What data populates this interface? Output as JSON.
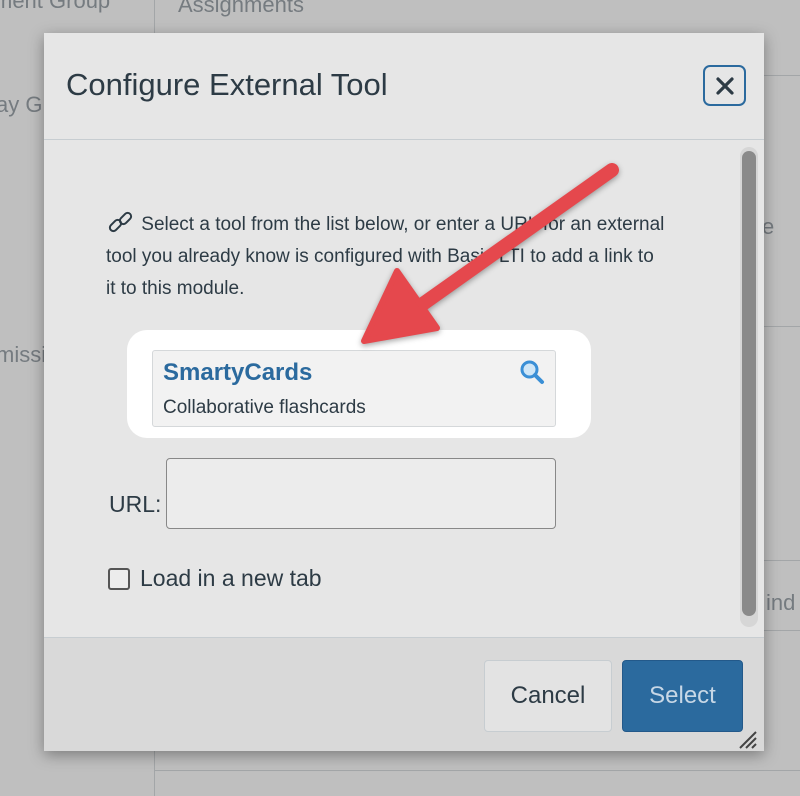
{
  "background": {
    "left_items": [
      "ment Group",
      "ay G",
      "missi"
    ],
    "main_items": [
      "Assignments",
      "e",
      "ind"
    ]
  },
  "modal": {
    "title": "Configure External Tool",
    "close_icon": "close-icon",
    "intro_text": "Select a tool from the list below, or enter a URL for an external tool you already know is configured with Basic LTI to add a link to it to this module.",
    "link_icon": "link-icon",
    "tools": [
      {
        "name": "SmartyCards",
        "description": "Collaborative flashcards",
        "icon": "search-icon"
      }
    ],
    "url_label": "URL:",
    "url_value": "",
    "new_tab_label": "Load in a new tab",
    "new_tab_checked": false,
    "cancel_label": "Cancel",
    "select_label": "Select"
  },
  "annotation": {
    "arrow_color": "#e5484d",
    "highlight_color": "#ffffff"
  },
  "colors": {
    "link_blue": "#2b6a9e",
    "primary_button": "#2b6a9e",
    "text": "#2d3b45"
  }
}
